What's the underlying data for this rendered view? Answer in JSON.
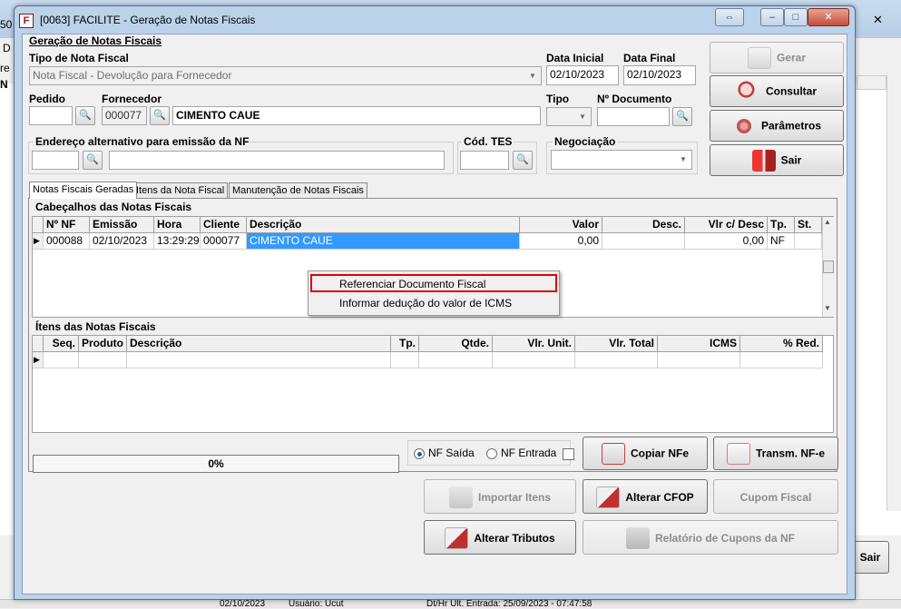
{
  "background": {
    "left_labels": [
      "50",
      "D",
      "re",
      "N"
    ],
    "close_glyph": "✕",
    "sair_label": "Sair"
  },
  "window": {
    "code_title": "[0063] FACILITE - Geração de Notas Fiscais",
    "icon_glyph": "F",
    "restore_glyph": "⇔",
    "minimize_glyph": "–",
    "maximize_glyph": "□",
    "close_glyph": "✕"
  },
  "form": {
    "section_title": "Geração de Notas Fiscais",
    "tipo_nota_label": "Tipo de Nota Fiscal",
    "tipo_nota_value": "Nota Fiscal - Devolução para Fornecedor",
    "data_inicial_label": "Data Inicial",
    "data_inicial_value": "02/10/2023",
    "data_final_label": "Data Final",
    "data_final_value": "02/10/2023",
    "pedido_label": "Pedido",
    "pedido_value": "",
    "fornecedor_label": "Fornecedor",
    "fornecedor_code": "000077",
    "fornecedor_name": "CIMENTO CAUE",
    "tipo_label": "Tipo",
    "tipo_value": "",
    "n_documento_label": "Nº Documento",
    "n_documento_value": "",
    "endereco_label": "Endereço alternativo para emissão da NF",
    "endereco_code": "",
    "endereco_value": "",
    "cod_tes_label": "Cód. TES",
    "cod_tes_value": "",
    "negociacao_label": "Negociação",
    "negociacao_value": "",
    "binoc_glyph": "🔍",
    "arrow_glyph": "▼"
  },
  "side_buttons": {
    "gerar": "Gerar",
    "consultar": "Consultar",
    "parametros": "Parâmetros",
    "sair": "Sair"
  },
  "tabs": [
    {
      "label": "Notas Fiscais Geradas"
    },
    {
      "label": "Itens da Nota Fiscal"
    },
    {
      "label": "Manutenção de Notas Fiscais"
    }
  ],
  "headers_grid": {
    "title": "Cabeçalhos das Notas Fiscais",
    "columns": [
      "Nº NF",
      "Emissão",
      "Hora",
      "Cliente",
      "Descrição",
      "Valor",
      "Desc.",
      "Vlr c/ Desc",
      "Tp.",
      "St."
    ],
    "row": {
      "indicator": "▶",
      "nf": "000088",
      "emissao": "02/10/2023",
      "hora": "13:29:29",
      "cliente": "000077",
      "descricao": "CIMENTO CAUE",
      "valor": "0,00",
      "desc": "",
      "vlr_desc": "0,00",
      "tp": "NF",
      "st": ""
    },
    "scroll_up": "▲",
    "scroll_down": "▼"
  },
  "context_menu": {
    "item1": "Referenciar Documento Fiscal",
    "item2": "Informar dedução do valor de ICMS"
  },
  "items_grid": {
    "title": "Ítens das Notas Fiscais",
    "columns": [
      "Seq.",
      "Produto",
      "Descrição",
      "Tp.",
      "Qtde.",
      "Vlr. Unit.",
      "Vlr. Total",
      "ICMS",
      "% Red."
    ],
    "indicator": "▶"
  },
  "bottom": {
    "progress_label": "0%",
    "progress_fraction": 0,
    "nf_saida": "NF Saída",
    "nf_entrada": "NF Entrada",
    "copiar_nfe": "Copiar NFe",
    "transm_nfe": "Transm. NF-e",
    "importar_itens": "Importar Itens",
    "alterar_cfop": "Alterar CFOP",
    "cupom_fiscal": "Cupom Fiscal",
    "alterar_tributos": "Alterar Tributos",
    "relatorio_cupons": "Relatório de Cupons da NF"
  },
  "status_bar": {
    "text1": "02/10/2023",
    "text2": "Usuário: Ucut",
    "text3": "Dt/Hr Ult. Entrada: 25/09/2023 - 07:47:58"
  }
}
